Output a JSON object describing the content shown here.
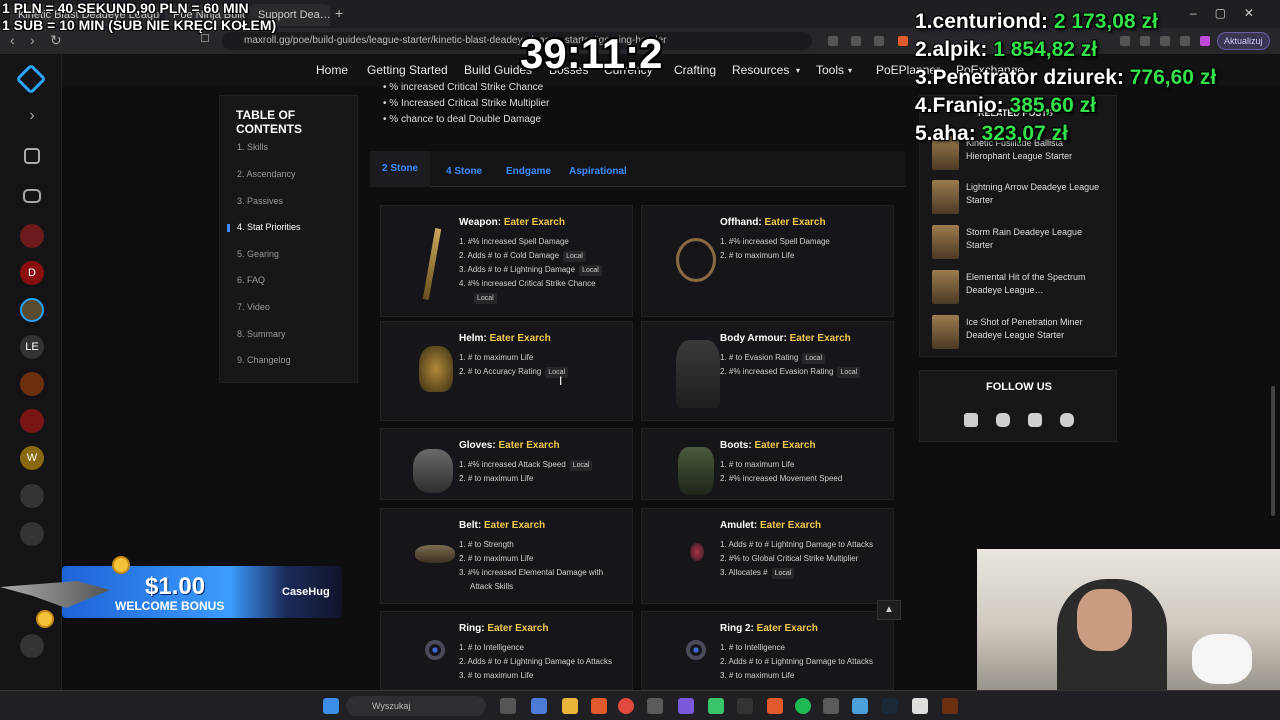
{
  "browser": {
    "tabs": [
      "Kinetic Blast Deadeye League…",
      "Poe Ninja Builds",
      "Support Dea…"
    ],
    "url": "maxroll.gg/poe/build-guides/league-starter/kinetic-blast-deadeye-league-starter#gearing-header",
    "update_label": "Aktualizuj"
  },
  "site_nav": {
    "items": [
      "Home",
      "Getting Started",
      "Build Guides",
      "Bosses",
      "Currency",
      "Crafting",
      "Resources",
      "Tools",
      "PoEPlanner",
      "PoExchange"
    ]
  },
  "toc": {
    "title": "TABLE OF CONTENTS",
    "items": [
      {
        "num": "1.",
        "label": "Skills"
      },
      {
        "num": "2.",
        "label": "Ascendancy"
      },
      {
        "num": "3.",
        "label": "Passives"
      },
      {
        "num": "4.",
        "label": "Stat Priorities"
      },
      {
        "num": "5.",
        "label": "Gearing"
      },
      {
        "num": "6.",
        "label": "FAQ"
      },
      {
        "num": "7.",
        "label": "Video"
      },
      {
        "num": "8.",
        "label": "Summary"
      },
      {
        "num": "9.",
        "label": "Changelog"
      }
    ],
    "active_index": 3
  },
  "stat_priorities": [
    "% increased Critical Strike Chance",
    "% Increased Critical Strike Multiplier",
    "% chance to deal Double Damage"
  ],
  "gear_tabs": [
    "2 Stone",
    "4 Stone",
    "Endgame",
    "Aspirational"
  ],
  "active_gear_tab": 0,
  "gear": [
    {
      "slot": "Weapon:",
      "boss": "Eater Exarch",
      "mods": [
        {
          "text": "#% increased Spell Damage",
          "tag": ""
        },
        {
          "text": "Adds # to # Cold Damage",
          "tag": "Local"
        },
        {
          "text": "Adds # to # Lightning Damage",
          "tag": "Local"
        },
        {
          "text": "#% increased Critical Strike Chance",
          "tag": ""
        },
        {
          "text": "",
          "tag": "Local"
        }
      ]
    },
    {
      "slot": "Offhand:",
      "boss": "Eater Exarch",
      "mods": [
        {
          "text": "#% increased Spell Damage",
          "tag": ""
        },
        {
          "text": "# to maximum Life",
          "tag": ""
        }
      ]
    },
    {
      "slot": "Helm:",
      "boss": "Eater Exarch",
      "mods": [
        {
          "text": "# to maximum Life",
          "tag": ""
        },
        {
          "text": "# to Accuracy Rating",
          "tag": "Local"
        }
      ]
    },
    {
      "slot": "Body Armour:",
      "boss": "Eater Exarch",
      "mods": [
        {
          "text": "# to Evasion Rating",
          "tag": "Local"
        },
        {
          "text": "#% increased Evasion Rating",
          "tag": "Local"
        }
      ]
    },
    {
      "slot": "Gloves:",
      "boss": "Eater Exarch",
      "mods": [
        {
          "text": "#% increased Attack Speed",
          "tag": "Local"
        },
        {
          "text": "# to maximum Life",
          "tag": ""
        }
      ]
    },
    {
      "slot": "Boots:",
      "boss": "Eater Exarch",
      "mods": [
        {
          "text": "# to maximum Life",
          "tag": ""
        },
        {
          "text": "#% increased Movement Speed",
          "tag": ""
        }
      ]
    },
    {
      "slot": "Belt:",
      "boss": "Eater Exarch",
      "mods": [
        {
          "text": "# to Strength",
          "tag": ""
        },
        {
          "text": "# to maximum Life",
          "tag": ""
        },
        {
          "text": "#% increased Elemental Damage with",
          "tag": ""
        },
        {
          "text": "Attack Skills",
          "tag": ""
        }
      ]
    },
    {
      "slot": "Amulet:",
      "boss": "Eater Exarch",
      "mods": [
        {
          "text": "Adds # to # Lightning Damage to Attacks",
          "tag": ""
        },
        {
          "text": "#% to Global Critical Strike Multiplier",
          "tag": ""
        },
        {
          "text": "Allocates #",
          "tag": "Local"
        }
      ]
    },
    {
      "slot": "Ring:",
      "boss": "Eater Exarch",
      "mods": [
        {
          "text": "# to Intelligence",
          "tag": ""
        },
        {
          "text": "Adds # to # Lightning Damage to Attacks",
          "tag": ""
        },
        {
          "text": "# to maximum Life",
          "tag": ""
        }
      ]
    },
    {
      "slot": "Ring 2:",
      "boss": "Eater Exarch",
      "mods": [
        {
          "text": "# to Intelligence",
          "tag": ""
        },
        {
          "text": "Adds # to # Lightning Damage to Attacks",
          "tag": ""
        },
        {
          "text": "# to maximum Life",
          "tag": ""
        }
      ]
    }
  ],
  "related": {
    "title": "RELATED POSTS",
    "items": [
      "Kinetic Fusillade Ballista Hierophant League Starter",
      "Lightning Arrow Deadeye League Starter",
      "Storm Rain Deadeye League Starter",
      "Elemental Hit of the Spectrum Deadeye League…",
      "Ice Shot of Penetration Miner Deadeye League Starter"
    ]
  },
  "follow": {
    "title": "FOLLOW US",
    "icons": [
      "twitch-icon",
      "instagram-icon",
      "youtube-icon",
      "discord-icon"
    ]
  },
  "overlay": {
    "line1": "1 PLN = 40 SEKUND,90 PLN = 60 MIN",
    "line2": "1 SUB = 10 MIN (SUB NIE KRĘCI KOŁEM)",
    "timer": "39:11:2",
    "leaderboard": [
      {
        "rank": "1.",
        "name": "centuriond:",
        "amount": "2 173,08 zł"
      },
      {
        "rank": "2.",
        "name": "alpik:",
        "amount": "1 854,82 zł"
      },
      {
        "rank": "3.",
        "name": "Penetrator dziurek:",
        "amount": "776,60 zł"
      },
      {
        "rank": "4.",
        "name": "Franio:",
        "amount": "385,60 zł"
      },
      {
        "rank": "5.",
        "name": "aha:",
        "amount": "323,07 zł"
      }
    ]
  },
  "banner": {
    "price": "$1.00",
    "bonus": "WELCOME BONUS",
    "brand": "CaseHug"
  },
  "taskbar": {
    "search_placeholder": "Wyszukaj"
  }
}
